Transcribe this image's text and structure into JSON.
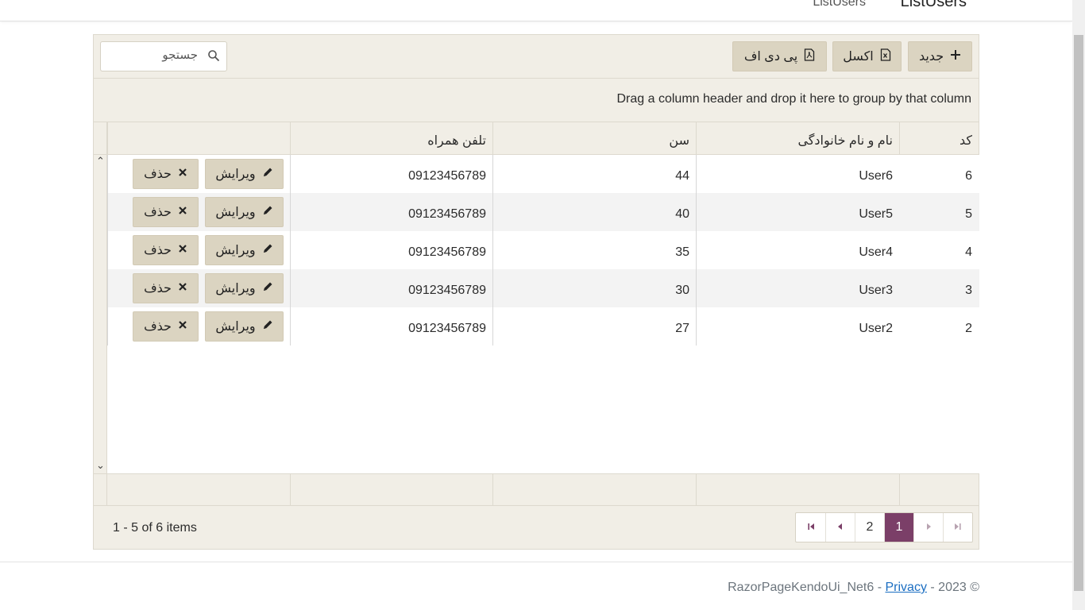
{
  "nav": {
    "links": [
      "ListUsers",
      "ListUsers"
    ]
  },
  "toolbar": {
    "new_label": "جدید",
    "excel_label": "اکسل",
    "pdf_label": "پی دی اف",
    "search_placeholder": "جستجو",
    "icons": [
      "plus-icon",
      "file-excel-icon",
      "file-pdf-icon",
      "search-icon"
    ]
  },
  "group_panel_text": "Drag a column header and drop it here to group by that column",
  "columns": [
    "کد",
    "نام و نام خانوادگی",
    "سن",
    "تلفن همراه"
  ],
  "rows": [
    {
      "id": "6",
      "name": "User6",
      "age": "44",
      "phone": "09123456789"
    },
    {
      "id": "5",
      "name": "User5",
      "age": "40",
      "phone": "09123456789"
    },
    {
      "id": "4",
      "name": "User4",
      "age": "35",
      "phone": "09123456789"
    },
    {
      "id": "3",
      "name": "User3",
      "age": "30",
      "phone": "09123456789"
    },
    {
      "id": "2",
      "name": "User2",
      "age": "27",
      "phone": "09123456789"
    }
  ],
  "row_actions": {
    "edit_label": "ویرایش",
    "delete_label": "حذف"
  },
  "pager": {
    "pages": [
      "1",
      "2"
    ],
    "current_page": "1",
    "info": "1 - 5 of 6 items"
  },
  "footer": {
    "copyright": "© 2023 -",
    "app_name": "RazorPageKendoUi_Net6",
    "separator": "-",
    "privacy_label": "Privacy"
  },
  "colors": {
    "accent": "#7b3f68",
    "button_bg": "#dbd4c1",
    "grid_bg": "#f1eee6",
    "link": "#1b6ec2"
  }
}
